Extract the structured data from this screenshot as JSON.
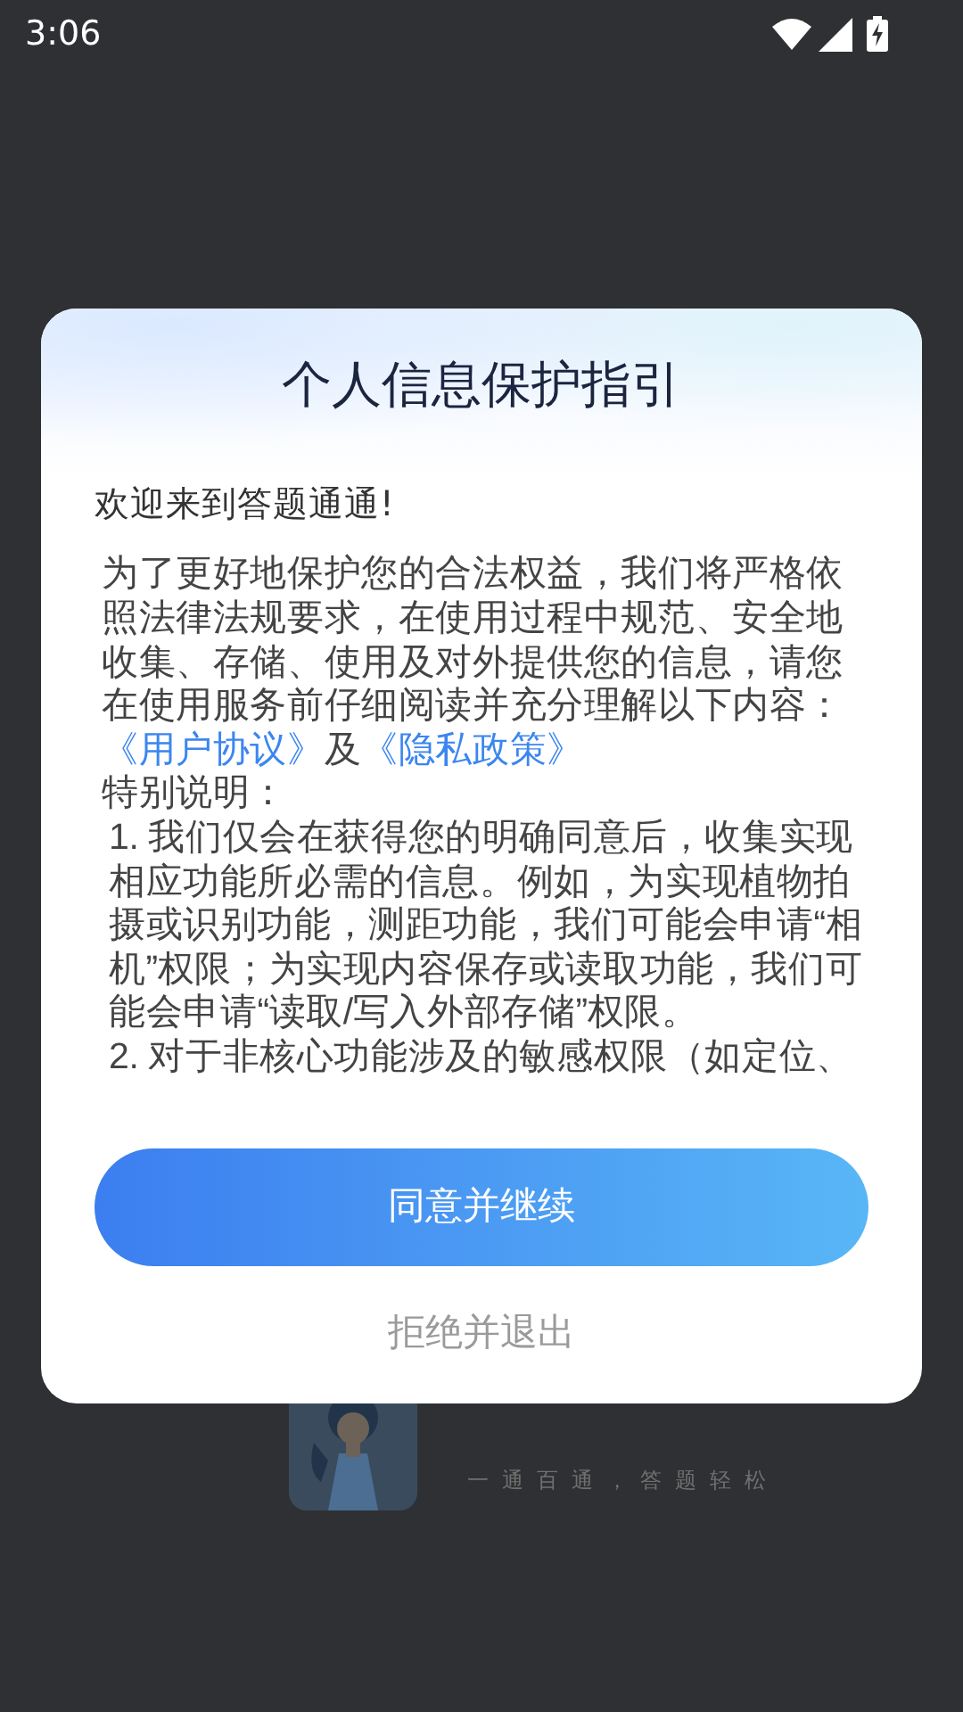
{
  "status_bar": {
    "time": "3:06"
  },
  "background_app": {
    "slogan": "一通百通，答题轻松"
  },
  "dialog": {
    "title": "个人信息保护指引",
    "greeting": "欢迎来到答题通通!",
    "intro": "为了更好地保护您的合法权益，我们将严格依照法律法规要求，在使用过程中规范、安全地收集、存储、使用及对外提供您的信息，请您在使用服务前仔细阅读并充分理解以下内容：",
    "links": [
      {
        "text": "《用户协议》"
      },
      {
        "text": "《隐私政策》"
      }
    ],
    "link_separator": "及",
    "note_heading": "特别说明：",
    "items": [
      "1. 我们仅会在获得您的明确同意后，收集实现相应功能所必需的信息。例如，为实现植物拍摄或识别功能，测距功能，我们可能会申请“相机”权限；为实现内容保存或读取功能，我们可能会申请“读取/写入外部存储”权限。",
      "2. 对于非核心功能涉及的敏感权限（如定位、"
    ],
    "agree_button": "同意并继续",
    "decline_button": "拒绝并退出"
  }
}
